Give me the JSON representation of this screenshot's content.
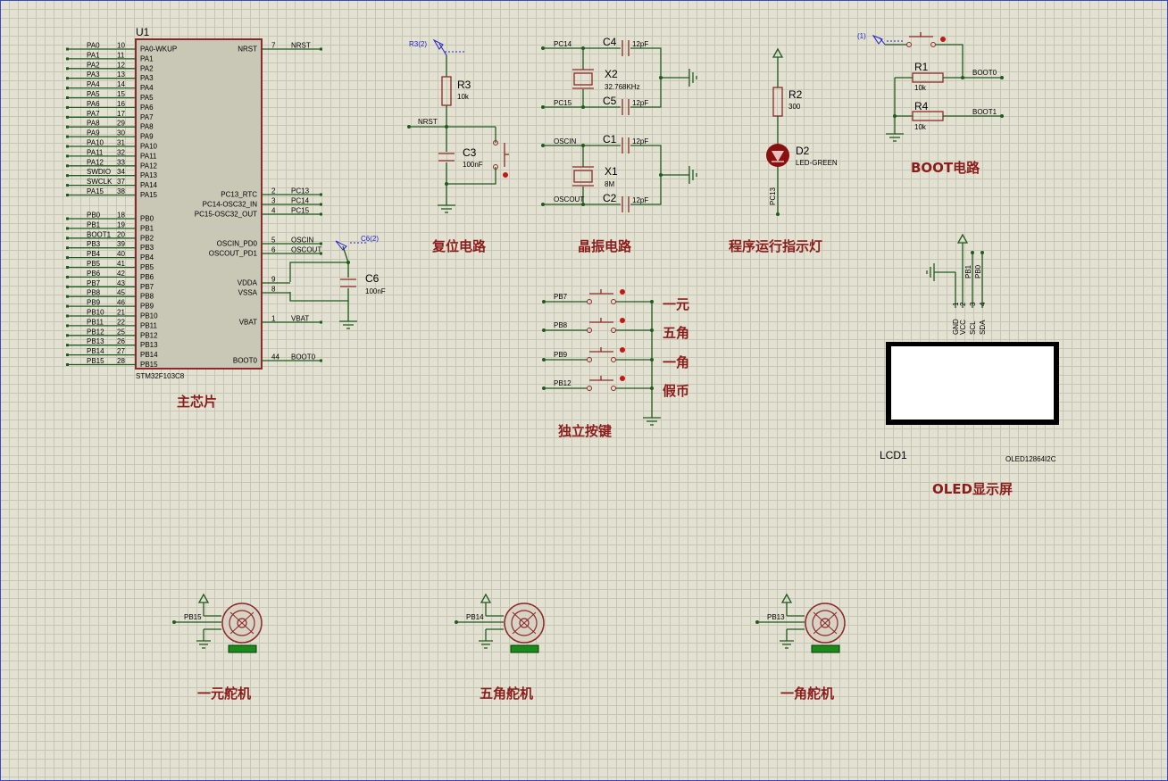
{
  "mcu": {
    "ref": "U1",
    "part": "STM32F103C8",
    "caption": "主芯片",
    "left_pins": [
      {
        "net": "PA0",
        "num": "10",
        "name": "PA0-WKUP"
      },
      {
        "net": "PA1",
        "num": "11",
        "name": "PA1"
      },
      {
        "net": "PA2",
        "num": "12",
        "name": "PA2"
      },
      {
        "net": "PA3",
        "num": "13",
        "name": "PA3"
      },
      {
        "net": "PA4",
        "num": "14",
        "name": "PA4"
      },
      {
        "net": "PA5",
        "num": "15",
        "name": "PA5"
      },
      {
        "net": "PA6",
        "num": "16",
        "name": "PA6"
      },
      {
        "net": "PA7",
        "num": "17",
        "name": "PA7"
      },
      {
        "net": "PA8",
        "num": "29",
        "name": "PA8"
      },
      {
        "net": "PA9",
        "num": "30",
        "name": "PA9"
      },
      {
        "net": "PA10",
        "num": "31",
        "name": "PA10"
      },
      {
        "net": "PA11",
        "num": "32",
        "name": "PA11"
      },
      {
        "net": "PA12",
        "num": "33",
        "name": "PA12"
      },
      {
        "net": "SWDIO",
        "num": "34",
        "name": "PA13"
      },
      {
        "net": "SWCLK",
        "num": "37",
        "name": "PA14"
      },
      {
        "net": "PA15",
        "num": "38",
        "name": "PA15"
      },
      {
        "net": "PB0",
        "num": "18",
        "name": "PB0"
      },
      {
        "net": "PB1",
        "num": "19",
        "name": "PB1"
      },
      {
        "net": "BOOT1",
        "num": "20",
        "name": "PB2"
      },
      {
        "net": "PB3",
        "num": "39",
        "name": "PB3"
      },
      {
        "net": "PB4",
        "num": "40",
        "name": "PB4"
      },
      {
        "net": "PB5",
        "num": "41",
        "name": "PB5"
      },
      {
        "net": "PB6",
        "num": "42",
        "name": "PB6"
      },
      {
        "net": "PB7",
        "num": "43",
        "name": "PB7"
      },
      {
        "net": "PB8",
        "num": "45",
        "name": "PB8"
      },
      {
        "net": "PB9",
        "num": "46",
        "name": "PB9"
      },
      {
        "net": "PB10",
        "num": "21",
        "name": "PB10"
      },
      {
        "net": "PB11",
        "num": "22",
        "name": "PB11"
      },
      {
        "net": "PB12",
        "num": "25",
        "name": "PB12"
      },
      {
        "net": "PB13",
        "num": "26",
        "name": "PB13"
      },
      {
        "net": "PB14",
        "num": "27",
        "name": "PB14"
      },
      {
        "net": "PB15",
        "num": "28",
        "name": "PB15"
      }
    ],
    "right_pins": [
      {
        "net": "NRST",
        "num": "7",
        "name": "NRST"
      },
      {
        "net": "PC13",
        "num": "2",
        "name": "PC13_RTC"
      },
      {
        "net": "PC14",
        "num": "3",
        "name": "PC14-OSC32_IN"
      },
      {
        "net": "PC15",
        "num": "4",
        "name": "PC15-OSC32_OUT"
      },
      {
        "net": "OSCIN",
        "num": "5",
        "name": "OSCIN_PD0"
      },
      {
        "net": "OSCOUT",
        "num": "6",
        "name": "OSCOUT_PD1"
      },
      {
        "net": "",
        "num": "9",
        "name": "VDDA"
      },
      {
        "net": "",
        "num": "8",
        "name": "VSSA"
      },
      {
        "net": "VBAT",
        "num": "1",
        "name": "VBAT"
      },
      {
        "net": "BOOT0",
        "num": "44",
        "name": "BOOT0"
      }
    ],
    "c6": {
      "ref": "C6",
      "value": "100nF",
      "probe": "C6(2)"
    }
  },
  "reset": {
    "caption": "复位电路",
    "probe": "R3(2)",
    "r3": {
      "ref": "R3",
      "value": "10k"
    },
    "c3": {
      "ref": "C3",
      "value": "100nF"
    },
    "net": "NRST"
  },
  "crystal": {
    "caption": "晶振电路",
    "c4": {
      "ref": "C4",
      "value": "12pF"
    },
    "x2": {
      "ref": "X2",
      "value": "32.768KHz"
    },
    "c5": {
      "ref": "C5",
      "value": "12pF"
    },
    "c1": {
      "ref": "C1",
      "value": "12pF"
    },
    "x1": {
      "ref": "X1",
      "value": "8M"
    },
    "c2": {
      "ref": "C2",
      "value": "12pF"
    },
    "nets": {
      "pc14": "PC14",
      "pc15": "PC15",
      "oscin": "OSCIN",
      "oscout": "OSCOUT"
    }
  },
  "indicator": {
    "caption": "程序运行指示灯",
    "r2": {
      "ref": "R2",
      "value": "300"
    },
    "d2": {
      "ref": "D2",
      "value": "LED-GREEN"
    },
    "net": "PC13"
  },
  "boot": {
    "caption": "BOOT电路",
    "probe": "(1)",
    "r1": {
      "ref": "R1",
      "value": "10k"
    },
    "r4": {
      "ref": "R4",
      "value": "10k"
    },
    "net0": "BOOT0",
    "net1": "BOOT1"
  },
  "buttons": {
    "caption": "独立按键",
    "items": [
      {
        "net": "PB7",
        "label": "一元"
      },
      {
        "net": "PB8",
        "label": "五角"
      },
      {
        "net": "PB9",
        "label": "一角"
      },
      {
        "net": "PB12",
        "label": "假币"
      }
    ]
  },
  "oled": {
    "caption": "OLED显示屏",
    "ref": "LCD1",
    "part": "OLED12864I2C",
    "pin_nets": [
      "PB1",
      "PB0"
    ],
    "pins": [
      {
        "num": "1",
        "name": "GND"
      },
      {
        "num": "2",
        "name": "VCC"
      },
      {
        "num": "3",
        "name": "SCL"
      },
      {
        "num": "4",
        "name": "SDA"
      }
    ]
  },
  "servos": [
    {
      "net": "PB15",
      "caption": "一元舵机"
    },
    {
      "net": "PB14",
      "caption": "五角舵机"
    },
    {
      "net": "PB13",
      "caption": "一角舵机"
    }
  ],
  "colors": {
    "grid_bg": "#e3e2d2",
    "wire": "#1f5a1f",
    "component": "#8a2a2a",
    "caption": "#8b1c1c",
    "chip_fill": "#c9c8b6"
  }
}
